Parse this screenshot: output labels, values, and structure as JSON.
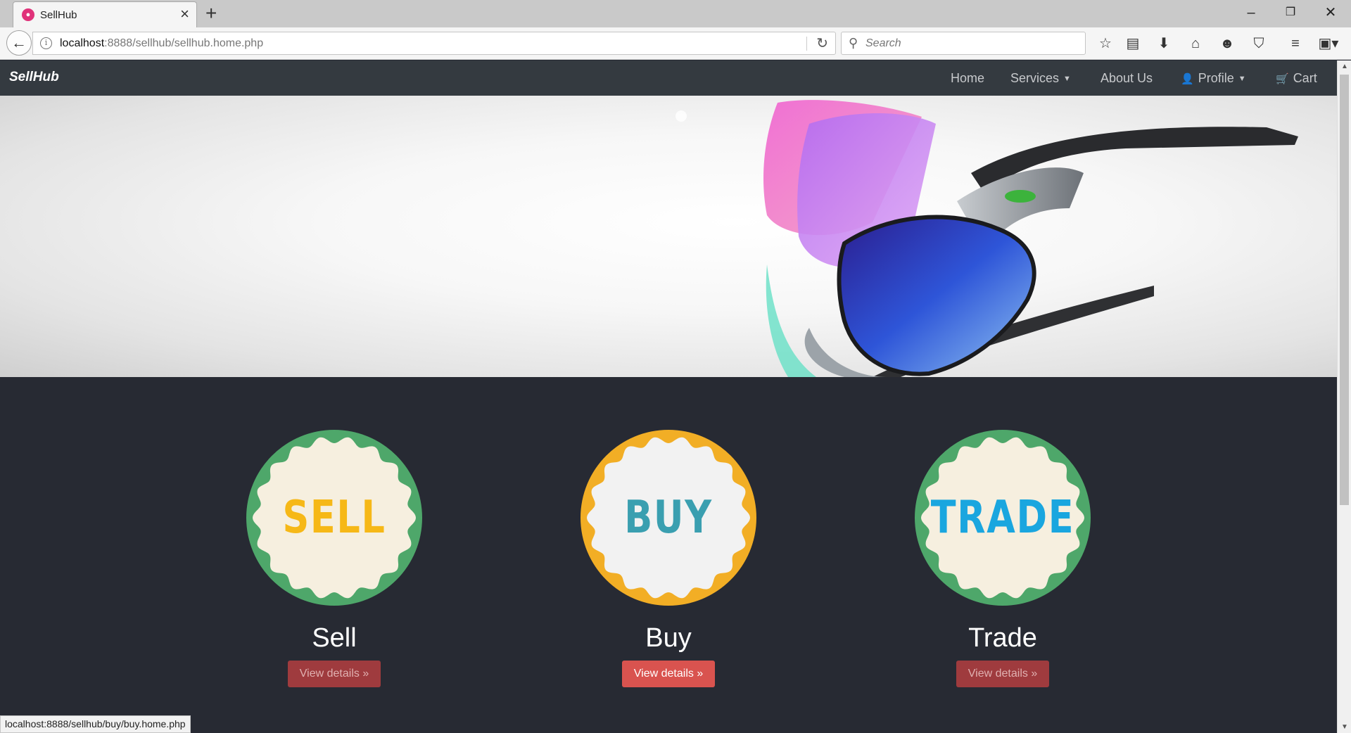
{
  "browser": {
    "tab_title": "SellHub",
    "tab_icon": "sellhub-favicon",
    "url_host": "localhost",
    "url_rest": ":8888/sellhub/sellhub.home.php",
    "search_placeholder": "Search",
    "status_url": "localhost:8888/sellhub/buy/buy.home.php"
  },
  "site": {
    "brand": "SellHub",
    "nav": {
      "home": "Home",
      "services": "Services",
      "about": "About Us",
      "profile": "Profile",
      "cart": "Cart"
    }
  },
  "features": [
    {
      "badge": "SELL",
      "title": "Sell",
      "button": "View details »",
      "badge_color": "#f6b817",
      "ring_color": "#4ea76a",
      "fill_color": "#f6efdf"
    },
    {
      "badge": "BUY",
      "title": "Buy",
      "button": "View details »",
      "badge_color": "#3a9fb0",
      "ring_color": "#f2ae25",
      "fill_color": "#f2f2f2"
    },
    {
      "badge": "TRADE",
      "title": "Trade",
      "button": "View details »",
      "badge_color": "#1aa6df",
      "ring_color": "#4ea76a",
      "fill_color": "#f6efdf"
    }
  ],
  "colors": {
    "page_bg": "#272a33",
    "navbar_bg": "#343a40",
    "button_bg": "#9f3b3e",
    "button_active_bg": "#d9534f"
  }
}
